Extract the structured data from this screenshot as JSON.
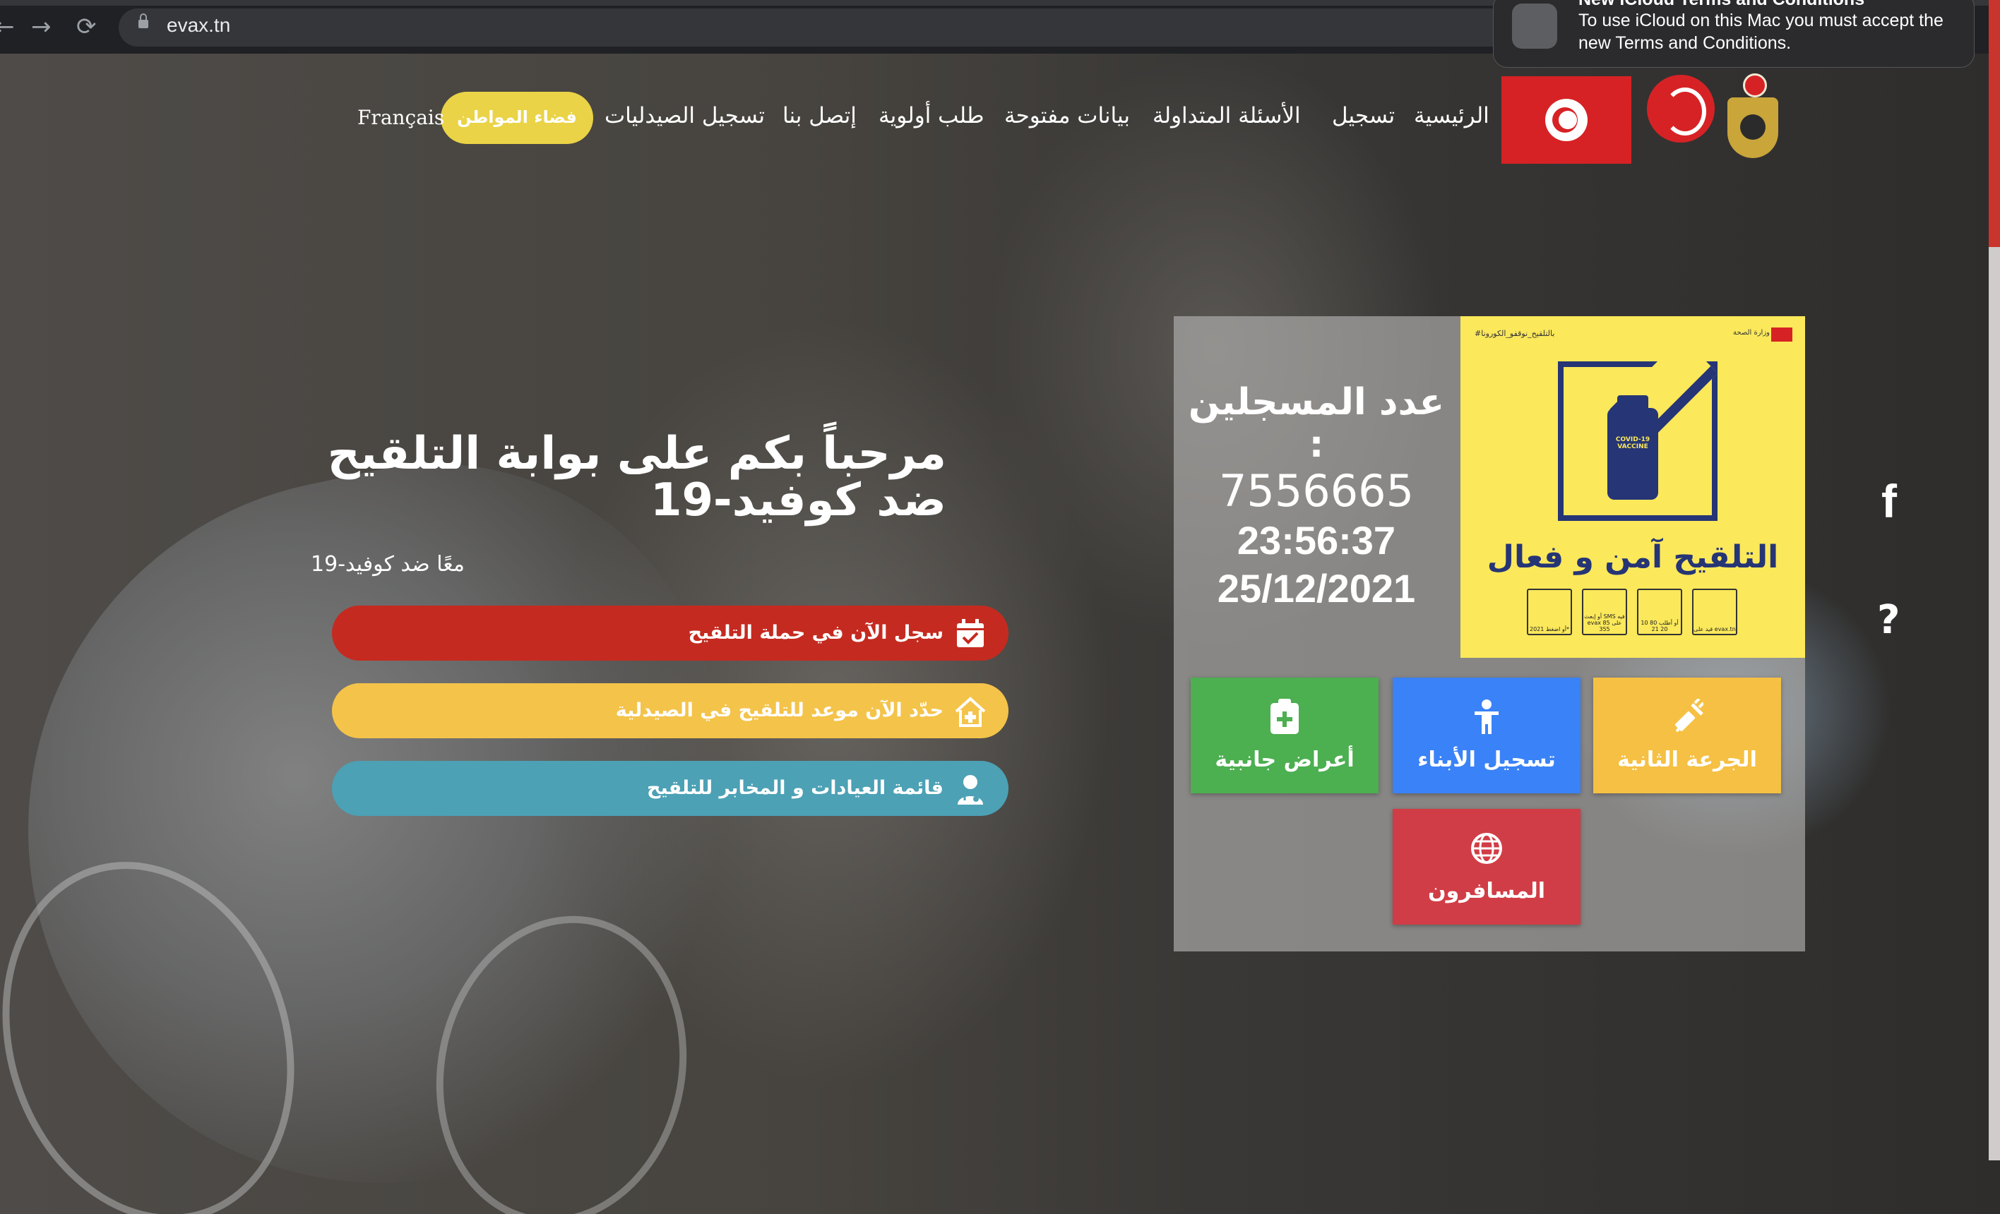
{
  "browser": {
    "url": "evax.tn",
    "back_icon": "arrow-left-icon",
    "forward_icon": "arrow-right-icon",
    "reload_icon": "reload-icon"
  },
  "notification": {
    "title": "New iCloud Terms and Conditions",
    "body": "To use iCloud on this Mac you must accept the new Terms and Conditions."
  },
  "nav": {
    "items": [
      "الرئيسية",
      "تسجيل",
      "الأسئلة المتداولة",
      "بيانات مفتوحة",
      "طلب أولوية",
      "إتصل بنا",
      "تسجيل الصيدليات"
    ],
    "citizen_button": "فضاء المواطن",
    "language": "Français"
  },
  "hero": {
    "title": "مرحباً بكم على بوابة التلقيح ضد كوفيد-19",
    "subtitle": "معًا ضد كوفيد-19"
  },
  "cta": {
    "register": "سجل الآن في حملة التلقيح",
    "pharmacy": "حدّد الآن موعد للتلقيح في الصيدلية",
    "clinics": "قائمة العيادات و المخابر للتلقيح"
  },
  "counter": {
    "label": "عدد المسجلين :",
    "value": "7556665",
    "time": "23:56:37",
    "date": "25/12/2021"
  },
  "poster": {
    "hashtag": "#بالتلقيح_نوقفو_الكورونا",
    "ministry": "وزارة الصحة",
    "vaccine_label": "COVID-19 VACCINE",
    "slogan": "التلقيح آمن و فعال",
    "icons": [
      {
        "caption": "أو اضغط 2021*"
      },
      {
        "caption": "أو إبعث SMS فيه evax على 85 355"
      },
      {
        "caption": "أو أطلب 80 10 20 21"
      },
      {
        "caption": "قيد على evax.tn"
      }
    ]
  },
  "tiles": {
    "side_effects": "أعراض جانبية",
    "children": "تسجيل الأبناء",
    "second_dose": "الجرعة الثانية",
    "travelers": "المسافرون"
  },
  "social": {
    "facebook": "f",
    "help": "?"
  },
  "colors": {
    "cta_red": "#c52a20",
    "cta_yellow": "#f4c34a",
    "cta_teal": "#4ca1b5",
    "tile_green": "#4caf50",
    "tile_blue": "#3a82f7",
    "tile_amber": "#f5c043",
    "tile_red": "#d13d46",
    "citizen": "#ead346",
    "poster_bg": "#fbe85b"
  }
}
